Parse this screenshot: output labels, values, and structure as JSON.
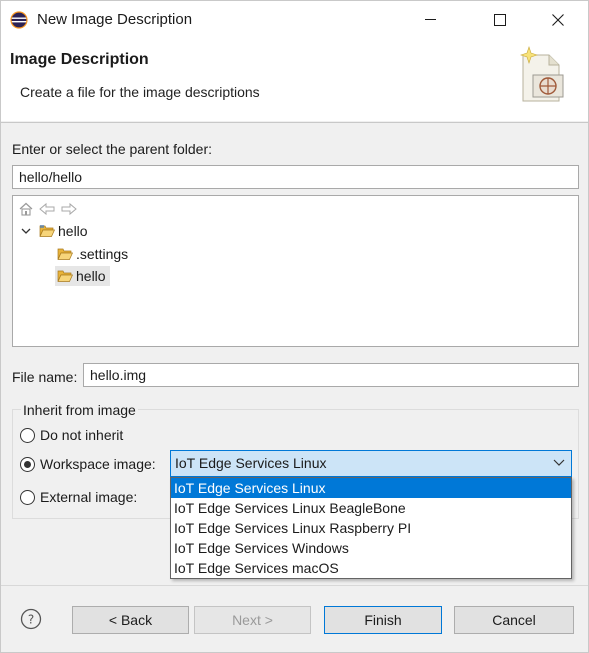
{
  "window": {
    "title": "New Image Description"
  },
  "banner": {
    "title": "Image Description",
    "subtitle": "Create a file for the image descriptions"
  },
  "parent_folder": {
    "label": "Enter or select the parent folder:",
    "value": "hello/hello"
  },
  "tree": {
    "items": [
      {
        "label": "hello",
        "level": 0,
        "expanded": true,
        "selected": false
      },
      {
        "label": ".settings",
        "level": 1,
        "expanded": false,
        "selected": false
      },
      {
        "label": "hello",
        "level": 1,
        "expanded": false,
        "selected": true
      }
    ]
  },
  "file_name": {
    "label": "File name:",
    "value": "hello.img"
  },
  "inherit": {
    "group_label": "Inherit from image",
    "options": [
      {
        "label": "Do not inherit",
        "checked": false
      },
      {
        "label": "Workspace image:",
        "checked": true
      },
      {
        "label": "External image:",
        "checked": false
      }
    ],
    "combo_value": "IoT Edge Services Linux",
    "dropdown_items": [
      "IoT Edge Services Linux",
      "IoT Edge Services Linux BeagleBone",
      "IoT Edge Services Linux Raspberry PI",
      "IoT Edge Services Windows",
      "IoT Edge Services macOS"
    ],
    "highlighted_index": 0
  },
  "buttons": {
    "back": "< Back",
    "next": "Next >",
    "finish": "Finish",
    "cancel": "Cancel"
  },
  "icons": {
    "app": "eclipse-icon",
    "help": "help-icon",
    "home": "home-icon",
    "back_nav": "back-arrow-icon",
    "forward_nav": "forward-arrow-icon"
  },
  "colors": {
    "accent": "#0078d7",
    "combo_bg": "#cce4f7",
    "folder": "#e8b33a"
  }
}
